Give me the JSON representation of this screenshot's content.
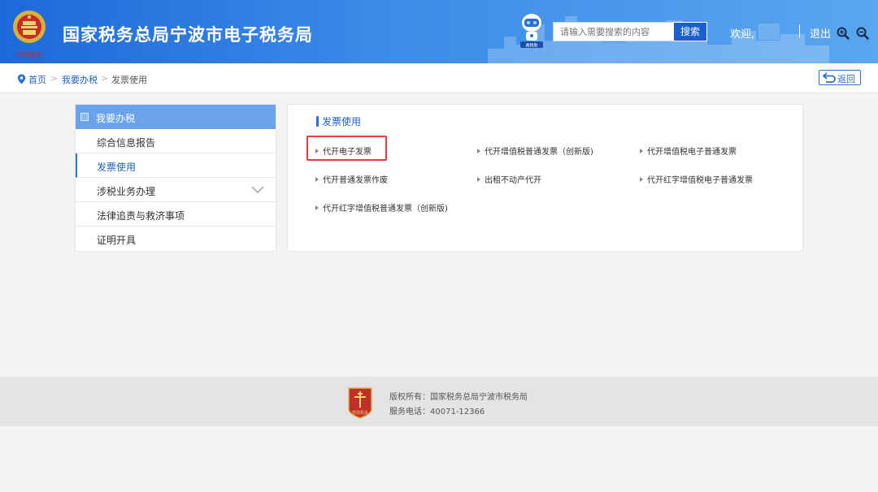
{
  "header": {
    "title": "国家税务总局宁波市电子税务局",
    "emblem_caption": "中国税务",
    "robot_caption": "甬税助",
    "search_placeholder": "请输入需要搜索的内容",
    "search_button": "搜索",
    "welcome": "欢迎,",
    "logout": "退出"
  },
  "breadcrumb": {
    "home": "首页",
    "sep": ">",
    "level1": "我要办税",
    "current": "发票使用",
    "back": "返回"
  },
  "sidebar": {
    "heading": "我要办税",
    "items": [
      {
        "label": "综合信息报告"
      },
      {
        "label": "发票使用"
      },
      {
        "label": "涉税业务办理"
      },
      {
        "label": "法律追责与救济事项"
      },
      {
        "label": "证明开具"
      }
    ]
  },
  "main": {
    "title": "发票使用",
    "links": [
      {
        "label": "代开电子发票"
      },
      {
        "label": "代开增值税普通发票（创新版)"
      },
      {
        "label": "代开增值税电子普通发票"
      },
      {
        "label": "代开普通发票作废"
      },
      {
        "label": "出租不动产代开"
      },
      {
        "label": "代开红字增值税电子普通发票"
      },
      {
        "label": "代开红字增值税普通发票（创新版)"
      }
    ]
  },
  "footer": {
    "copyright": "版权所有：国家税务总局宁波市税务局",
    "phone": "服务电话：40071-12366",
    "badge_caption": "党政机关"
  },
  "colors": {
    "header_blue": "#1e69d9",
    "accent": "#2d72cf",
    "highlight_red": "#e53c3c"
  }
}
